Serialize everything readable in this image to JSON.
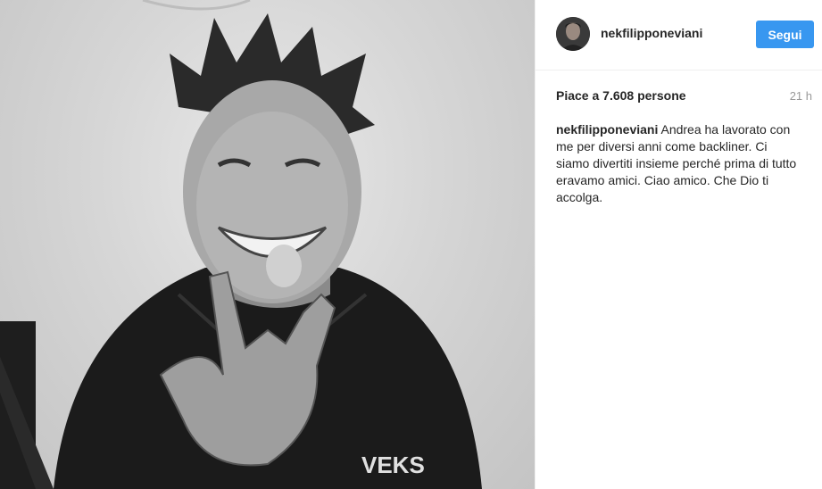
{
  "post": {
    "image_description": "",
    "author": {
      "username": "nekfilipponeviani"
    },
    "follow_label": "Segui",
    "likes_text": "Piace a 7.608 persone",
    "timestamp": "21 h",
    "caption": {
      "username": "nekfilipponeviani",
      "text": "Andrea ha lavorato con me per diversi anni come backliner. Ci siamo divertiti insieme perché prima di tutto eravamo amici. Ciao amico. Che Dio ti accolga."
    }
  },
  "colors": {
    "accent": "#3897f0",
    "text": "#262626",
    "muted": "#999999",
    "divider": "#efefef"
  }
}
